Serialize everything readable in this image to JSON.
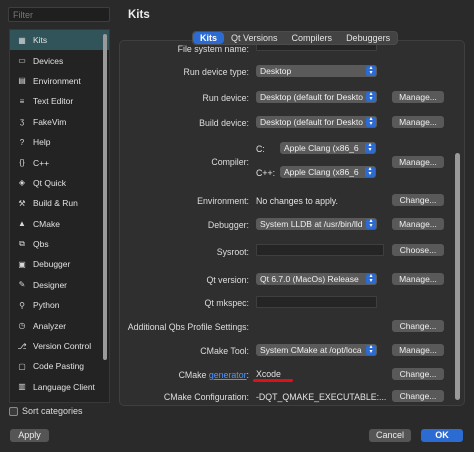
{
  "filter": {
    "placeholder": "Filter"
  },
  "nav": {
    "items": [
      {
        "label": "Kits",
        "icon": "kits-icon",
        "glyph": "▦"
      },
      {
        "label": "Devices",
        "icon": "devices-icon",
        "glyph": "▭"
      },
      {
        "label": "Environment",
        "icon": "environment-icon",
        "glyph": "▤"
      },
      {
        "label": "Text Editor",
        "icon": "text-editor-icon",
        "glyph": "≡"
      },
      {
        "label": "FakeVim",
        "icon": "fakevim-icon",
        "glyph": "ʒ"
      },
      {
        "label": "Help",
        "icon": "help-icon",
        "glyph": "?"
      },
      {
        "label": "C++",
        "icon": "cpp-icon",
        "glyph": "{}"
      },
      {
        "label": "Qt Quick",
        "icon": "qt-quick-icon",
        "glyph": "◈"
      },
      {
        "label": "Build & Run",
        "icon": "build-run-icon",
        "glyph": "⚒"
      },
      {
        "label": "CMake",
        "icon": "cmake-icon",
        "glyph": "▲"
      },
      {
        "label": "Qbs",
        "icon": "qbs-icon",
        "glyph": "⧉"
      },
      {
        "label": "Debugger",
        "icon": "debugger-icon",
        "glyph": "▣"
      },
      {
        "label": "Designer",
        "icon": "designer-icon",
        "glyph": "✎"
      },
      {
        "label": "Python",
        "icon": "python-icon",
        "glyph": "⚲"
      },
      {
        "label": "Analyzer",
        "icon": "analyzer-icon",
        "glyph": "◷"
      },
      {
        "label": "Version Control",
        "icon": "version-control-icon",
        "glyph": "⎇"
      },
      {
        "label": "Code Pasting",
        "icon": "code-pasting-icon",
        "glyph": "▢"
      },
      {
        "label": "Language Client",
        "icon": "language-client-icon",
        "glyph": "▥"
      }
    ]
  },
  "sort_label": "Sort categories",
  "apply_label": "Apply",
  "page_title": "Kits",
  "tabs": [
    "Kits",
    "Qt Versions",
    "Compilers",
    "Debuggers"
  ],
  "form": {
    "fs_name": "File system name:",
    "run_device_type": {
      "label": "Run device type:",
      "value": "Desktop"
    },
    "run_device": {
      "label": "Run device:",
      "value": "Desktop (default for Deskto",
      "button": "Manage..."
    },
    "build_device": {
      "label": "Build device:",
      "value": "Desktop (default for Deskto",
      "button": "Manage..."
    },
    "compiler": {
      "label": "Compiler:",
      "c_label": "C:",
      "c_value": "Apple Clang (x86_6",
      "cpp_label": "C++:",
      "cpp_value": "Apple Clang (x86_6",
      "button": "Manage..."
    },
    "environment": {
      "label": "Environment:",
      "value": "No changes to apply.",
      "button": "Change..."
    },
    "debugger": {
      "label": "Debugger:",
      "value": "System LLDB at /usr/bin/lld",
      "button": "Manage..."
    },
    "sysroot": {
      "label": "Sysroot:",
      "button": "Choose..."
    },
    "qt_version": {
      "label": "Qt version:",
      "value": "Qt 6.7.0 (MacOs) Release",
      "button": "Manage..."
    },
    "qt_mkspec": {
      "label": "Qt mkspec:"
    },
    "qbs_profile": {
      "label": "Additional Qbs Profile Settings:",
      "button": "Change..."
    },
    "cmake_tool": {
      "label": "CMake Tool:",
      "value": "System CMake at /opt/loca",
      "button": "Manage..."
    },
    "cmake_generator": {
      "label_pre": "CMake ",
      "label_link": "generator",
      "label_post": ":",
      "value": "Xcode",
      "button": "Change..."
    },
    "cmake_config": {
      "label": "CMake Configuration:",
      "value": "-DQT_QMAKE_EXECUTABLE:...",
      "button": "Change..."
    }
  },
  "cancel_label": "Cancel",
  "ok_label": "OK",
  "colors": {
    "accent": "#2c6bd2",
    "active_nav": "#31545a",
    "highlight": "#e0101a"
  }
}
